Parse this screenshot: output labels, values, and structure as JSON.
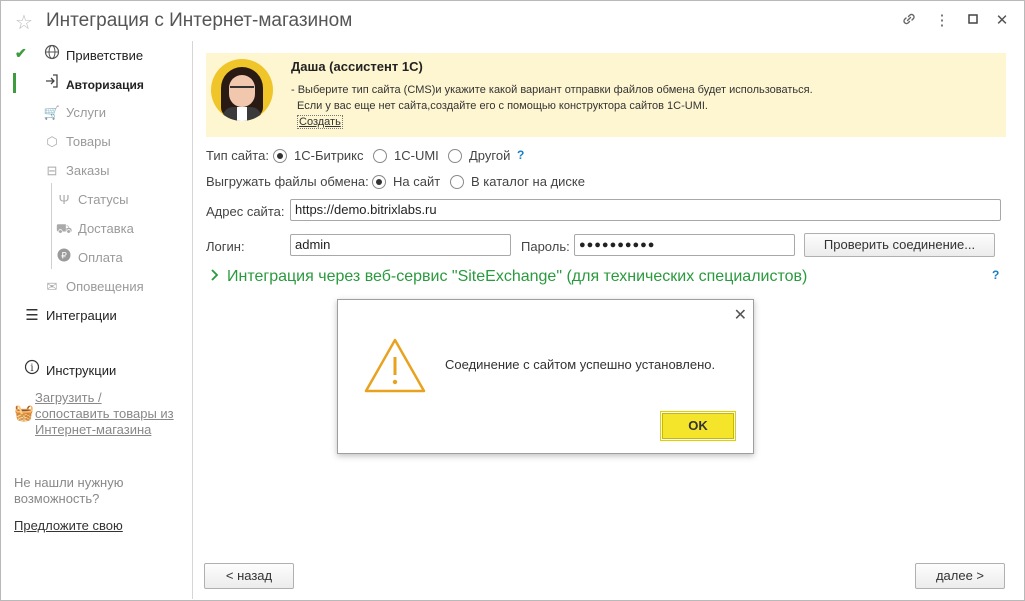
{
  "window": {
    "title": "Интеграция с Интернет-магазином"
  },
  "sidebar": {
    "items": [
      {
        "label": "Приветствие"
      },
      {
        "label": "Авторизация"
      },
      {
        "label": "Услуги"
      },
      {
        "label": "Товары"
      },
      {
        "label": "Заказы"
      },
      {
        "label": "Статусы"
      },
      {
        "label": "Доставка"
      },
      {
        "label": "Оплата"
      },
      {
        "label": "Оповещения"
      },
      {
        "label": "Интеграции"
      }
    ],
    "instructions_label": "Инструкции",
    "import_link": [
      "Загрузить /",
      "сопоставить товары из",
      "Интернет-магазина"
    ],
    "not_found": [
      "Не нашли нужную",
      "возможность?"
    ],
    "suggest_link": "Предложите свою"
  },
  "assistant": {
    "name": "Даша (ассистент 1С)",
    "line1": "- Выберите тип сайта (CMS)и укажите какой вариант отправки файлов обмена будет использоваться.",
    "line2": "Если у вас еще нет сайта,создайте его с помощью конструктора сайтов 1С-UMI.",
    "create_link": "Создать"
  },
  "form": {
    "site_type_label": "Тип сайта:",
    "site_type_options": [
      "1С-Битрикс",
      "1С-UMI",
      "Другой"
    ],
    "site_type_selected": "1С-Битрикс",
    "help_mark": "?",
    "export_label": "Выгружать файлы обмена:",
    "export_options": [
      "На сайт",
      "В каталог на диске"
    ],
    "export_selected": "На сайт",
    "address_label": "Адрес сайта:",
    "address_value": "https://demo.bitrixlabs.ru",
    "login_label": "Логин:",
    "login_value": "admin",
    "password_label": "Пароль:",
    "password_value": "●●●●●●●●●●",
    "check_button": "Проверить соединение...",
    "collapse_label": "Интеграция через веб-сервис \"SiteExchange\" (для технических специалистов)"
  },
  "dialog": {
    "message": "Соединение с сайтом успешно установлено.",
    "ok": "OK"
  },
  "footer": {
    "back": "< назад",
    "next": "далее >"
  },
  "colors": {
    "accent_green": "#3e9c3e",
    "link_green": "#2a9a3e",
    "banner_bg": "#fdf6d1",
    "ok_yellow": "#f5e52a",
    "warning_orange": "#e8a21f"
  }
}
